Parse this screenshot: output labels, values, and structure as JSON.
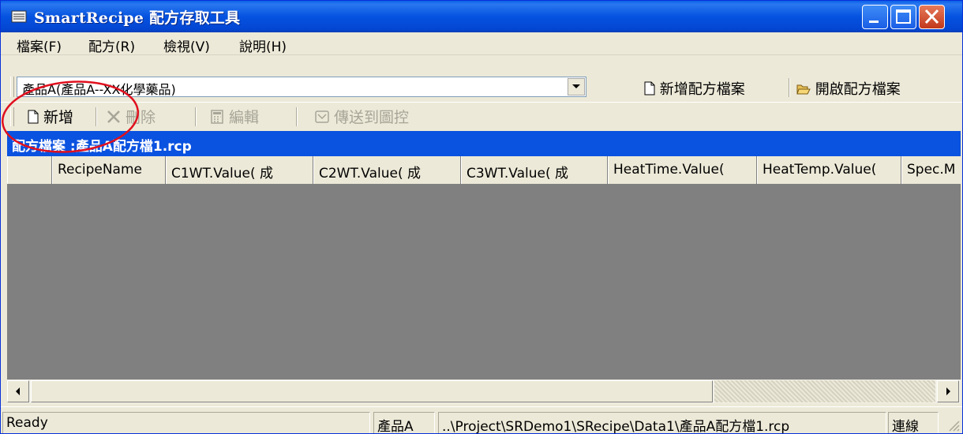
{
  "window": {
    "title": "SmartRecipe 配方存取工具"
  },
  "menu": [
    "檔案(F)",
    "配方(R)",
    "檢視(V)",
    "說明(H)"
  ],
  "recipe_select": {
    "value": "產品A(產品A--XX化學藥品)"
  },
  "recipe_actions": {
    "new_file": "新增配方檔案",
    "open_file": "開啟配方檔案"
  },
  "toolbar": {
    "add": "新增",
    "delete": "刪除",
    "edit": "編輯",
    "send": "傳送到圖控"
  },
  "file_caption": "配方檔案 :產品A配方檔1.rcp",
  "columns": [
    "RecipeName",
    "C1WT.Value( 成",
    "C2WT.Value( 成",
    "C3WT.Value( 成",
    "HeatTime.Value(",
    "HeatTemp.Value(",
    "Spec.M"
  ],
  "status": {
    "ready": "Ready",
    "product": "產品A",
    "path": "..\\Project\\SRDemo1\\SRecipe\\Data1\\產品A配方檔1.rcp",
    "connection": "連線"
  },
  "colors": {
    "titlebar": "#0553e0",
    "caption": "#0a52e0",
    "annotation": "#e0101e",
    "grid_bg": "#808080"
  }
}
